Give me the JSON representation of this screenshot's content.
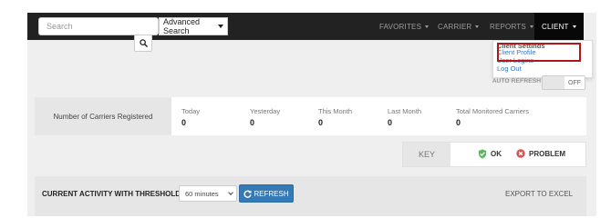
{
  "navbar": {
    "search_placeholder": "Search",
    "advanced_search_label": "Advanced Search",
    "menu": {
      "favorites": "FAVORITES",
      "carrier": "CARRIER",
      "reports": "REPORTS",
      "client": "CLIENT"
    }
  },
  "client_dropdown": {
    "header": "Client Settings",
    "items": [
      "Client Profile",
      "User Logins",
      "Log Out"
    ]
  },
  "auto_refresh": {
    "label": "AUTO REFRESH",
    "state": "OFF"
  },
  "stats": {
    "title": "Number of Carriers Registered",
    "items": [
      {
        "label": "Today",
        "value": "0"
      },
      {
        "label": "Yesterday",
        "value": "0"
      },
      {
        "label": "This Month",
        "value": "0"
      },
      {
        "label": "Last Month",
        "value": "0"
      },
      {
        "label": "Total Monitored Carriers",
        "value": "0"
      }
    ]
  },
  "key": {
    "label": "KEY",
    "ok": "OK",
    "problem": "PROBLEM"
  },
  "activity": {
    "title": "CURRENT ACTIVITY WITH THRESHOLD",
    "threshold_value": "60 minutes",
    "refresh_label": "REFRESH",
    "export_label": "EXPORT TO EXCEL"
  },
  "colors": {
    "navbar_bg": "#222222",
    "link": "#337ab7",
    "primary_button": "#337ab7",
    "ok_green": "#5cb85c",
    "problem_red": "#d9534f",
    "highlight_border": "#b3161a"
  }
}
